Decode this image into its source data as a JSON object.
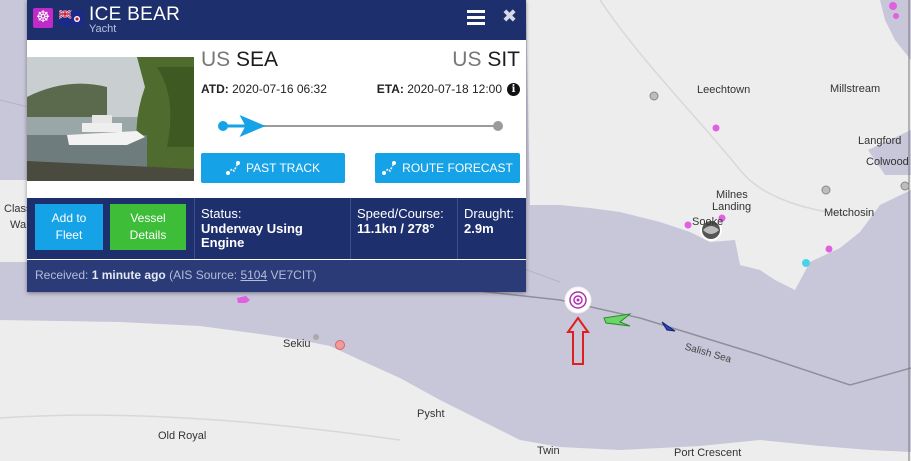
{
  "vessel": {
    "name": "ICE BEAR",
    "type": "Yacht",
    "type_icon": "helm-wheel-icon",
    "flag_icon": "cayman-islands-flag-icon"
  },
  "route": {
    "from_country": "US",
    "from_port": "SEA",
    "to_country": "US",
    "to_port": "SIT",
    "atd_label": "ATD:",
    "atd_value": "2020-07-16 06:32",
    "eta_label": "ETA:",
    "eta_value": "2020-07-18 12:00",
    "progress": 0.1
  },
  "buttons": {
    "past_track": "PAST TRACK",
    "route_forecast": "ROUTE FORECAST",
    "add_to_fleet_1": "Add to",
    "add_to_fleet_2": "Fleet",
    "vessel_details_1": "Vessel",
    "vessel_details_2": "Details"
  },
  "info": {
    "status_label": "Status:",
    "status_value_1": "Underway Using",
    "status_value_2": "Engine",
    "speed_label": "Speed/Course:",
    "speed_value": "11.1kn / 278°",
    "draught_label": "Draught:",
    "draught_value": "2.9m"
  },
  "received": {
    "prefix": "Received:",
    "age": "1 minute ago",
    "source_prefix": "(AIS Source:",
    "source_id": "5104",
    "source_suffix": "VE7CIT)"
  },
  "map_labels": {
    "leechtown": "Leechtown",
    "millstream": "Millstream",
    "langford": "Langford",
    "colwood": "Colwood",
    "milnes_1": "Milnes",
    "milnes_2": "Landing",
    "sooke": "Sooke",
    "metchosin": "Metchosin",
    "class": "Class",
    "wa": "Wa",
    "sekiu": "Sekiu",
    "salish_sea": "Salish Sea",
    "pysht": "Pysht",
    "old_royal": "Old Royal",
    "twin": "Twin",
    "port_crescent": "Port Crescent"
  },
  "colors": {
    "header": "#1e2f6d",
    "accent": "#16a2e6",
    "green": "#3dbd38",
    "sea": "#c8c6d9",
    "land": "#ededed"
  }
}
